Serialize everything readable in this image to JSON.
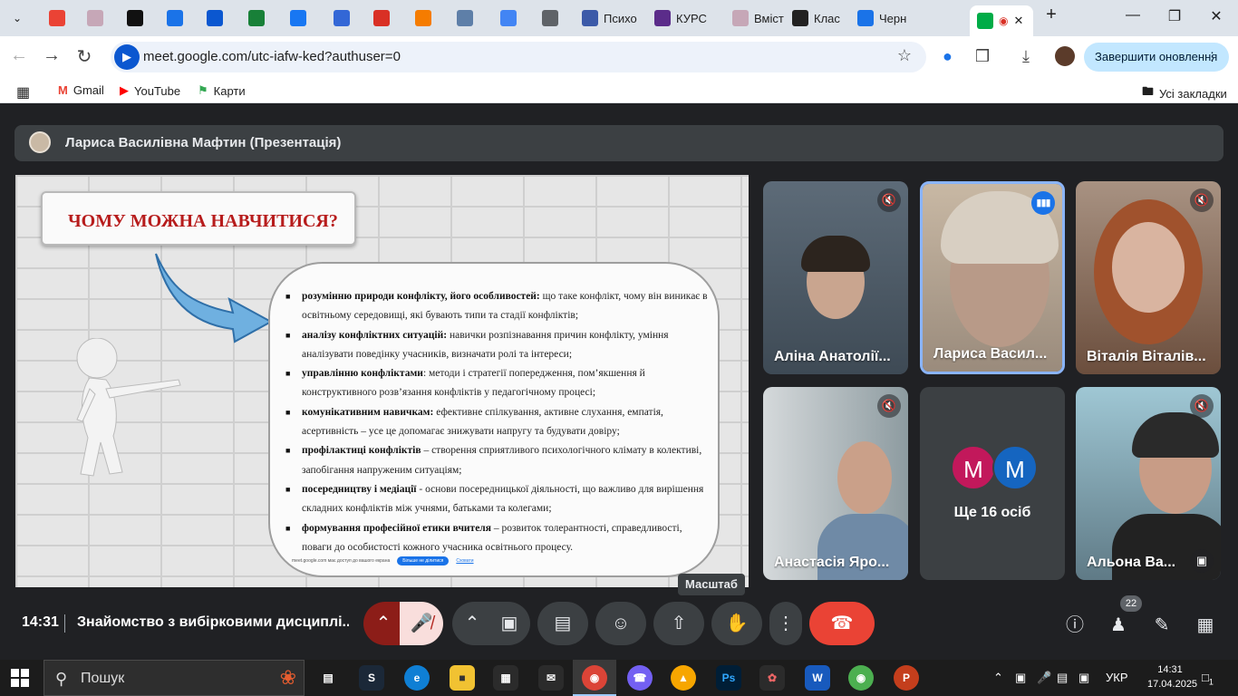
{
  "browser": {
    "tabs": [
      {
        "label": "",
        "color": "#ea4335"
      },
      {
        "label": "",
        "color": "#c6a7b7"
      },
      {
        "label": "",
        "color": "#111111"
      },
      {
        "label": "",
        "color": "#1a73e8"
      },
      {
        "label": "",
        "color": "#0b57d0"
      },
      {
        "label": "",
        "color": "#188038"
      },
      {
        "label": "",
        "color": "#1877f2"
      },
      {
        "label": "",
        "color": "#3367d6"
      },
      {
        "label": "",
        "color": "#d93025"
      },
      {
        "label": "",
        "color": "#f57c00"
      },
      {
        "label": "",
        "color": "#5e7fa8"
      },
      {
        "label": "",
        "color": "#4285f4"
      },
      {
        "label": "",
        "color": "#5f6368"
      },
      {
        "label": "Психо",
        "color": "#3c5aa8"
      },
      {
        "label": "КУРС",
        "color": "#5b2c8a"
      },
      {
        "label": "Вміст",
        "color": "#c6a7b7"
      },
      {
        "label": "Клас",
        "color": "#222222"
      },
      {
        "label": "Черн",
        "color": "#1a73e8"
      }
    ],
    "active_tab": {
      "label": "",
      "color": "#00ac47"
    },
    "new_tab": "+",
    "url": "meet.google.com/utc-iafw-ked?authuser=0",
    "update_button": "Завершити оновлення",
    "bookmarks": [
      {
        "label": "Gmail",
        "icon": "gmail-icon"
      },
      {
        "label": "YouTube",
        "icon": "youtube-icon"
      },
      {
        "label": "Карти",
        "icon": "maps-icon"
      }
    ],
    "all_bookmarks": "Усі закладки"
  },
  "meet": {
    "presenter": "Лариса Василівна Мафтин (Презентація)",
    "slide": {
      "title": "ЧОМУ МОЖНА НАВЧИТИСЯ?",
      "bullets": [
        {
          "bold": "розумінню природи конфлікту, його особливостей:",
          "text": " що таке конфлікт, чому він виникає в освітньому середовищі, які бувають типи та стадії конфліктів;"
        },
        {
          "bold": "аналізу конфліктних ситуацій:",
          "text": " навички розпізнавання причин конфлікту, уміння аналізувати поведінку учасників, визначати ролі та інтереси;"
        },
        {
          "bold": "управлінню конфліктами",
          "text": ": методи і стратегії попередження, пом’якшення й конструктивного розв’язання конфліктів у педагогічному процесі;"
        },
        {
          "bold": "комунікативним навичкам:",
          "text": " ефективне спілкування, активне слухання, емпатія, асертивність – усе це допомагає знижувати напругу та будувати довіру;"
        },
        {
          "bold": "профілактиці конфліктів",
          "text": " – створення сприятливого психологічного клімату в колективі, запобігання напруженим ситуаціям;"
        },
        {
          "bold": "посередництву і медіації",
          "text": " - основи посередницької діяльності, що важливо для вирішення складних конфліктів між учнями, батьками та колегами;"
        },
        {
          "bold": "формування професійної етики вчителя",
          "text": " – розвиток толерантності, справедливості, поваги до особистості кожного учасника освітнього процесу."
        }
      ],
      "cookie_text": "meet.google.com має доступ до вашого екрана",
      "cookie_ok": "Більше не ділитися",
      "cookie_link": "Сховати"
    },
    "participants": [
      {
        "name": "Аліна Анатолії...",
        "muted": true,
        "bg": "#4a5a6a"
      },
      {
        "name": "Лариса Васил...",
        "muted": false,
        "speaking": true,
        "bg": "#b7a99a"
      },
      {
        "name": "Віталія Віталів...",
        "muted": true,
        "bg": "#6b4e3d"
      },
      {
        "name": "Анастасія Яро...",
        "muted": true,
        "bg": "#7a8a90"
      },
      {
        "name": "Альона Ва...",
        "muted": true,
        "bg": "#5f7a86"
      }
    ],
    "others": {
      "avatars": [
        {
          "letter": "M",
          "color": "#c2185b"
        },
        {
          "letter": "M",
          "color": "#1565c0"
        }
      ],
      "label": "Ще 16 осіб"
    },
    "tooltip": "Масштаб",
    "time": "14:31",
    "meeting_title": "Знайомство з вибірковими дисциплі...",
    "participant_count": "22"
  },
  "taskbar": {
    "search": "Пошук",
    "lang": "УКР",
    "time": "14:31",
    "date": "17.04.2025",
    "notifications": "1"
  }
}
